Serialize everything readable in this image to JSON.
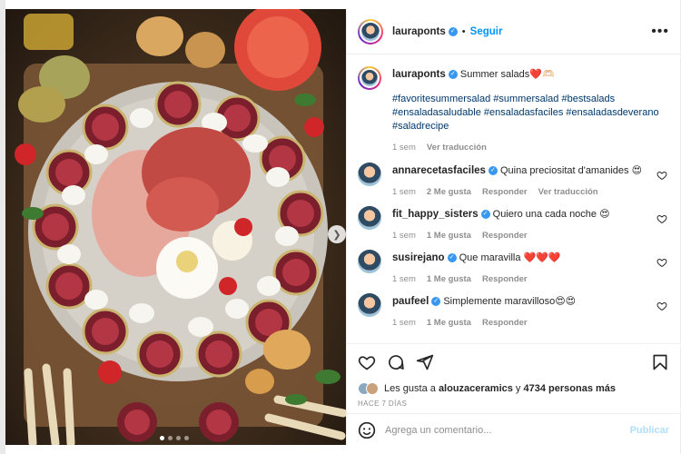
{
  "post": {
    "author": "lauraponts",
    "follow_label": "Seguir",
    "more_label": "•••",
    "caption_text": "Summer salads❤️🫶🏻",
    "hashtags": "#favoritesummersalad #summersalad #bestsalads #ensaladasaludable #ensaladasfaciles #ensaladasdeverano #saladrecipe",
    "caption_time": "1 sem",
    "caption_translate": "Ver traducción"
  },
  "comments": [
    {
      "user": "annarecetasfaciles",
      "text": "Quina preciositat d'amanides 😍",
      "time": "1 sem",
      "likes": "2 Me gusta",
      "reply": "Responder",
      "translate": "Ver traducción"
    },
    {
      "user": "fit_happy_sisters",
      "text": "Quiero una cada noche 😍",
      "time": "1 sem",
      "likes": "1 Me gusta",
      "reply": "Responder"
    },
    {
      "user": "susirejano",
      "text": "Que maravilla ❤️❤️❤️",
      "time": "1 sem",
      "likes": "1 Me gusta",
      "reply": "Responder"
    },
    {
      "user": "paufeel",
      "text": "Simplemente maravilloso😍😍",
      "time": "1 sem",
      "likes": "1 Me gusta",
      "reply": "Responder"
    }
  ],
  "likes": {
    "prefix": "Les gusta a ",
    "user": "alouzaceramics",
    "middle": " y ",
    "count": "4734 personas más"
  },
  "date": "HACE 7 DÍAS",
  "comment_box": {
    "placeholder": "Agrega un comentario...",
    "publish_label": "Publicar"
  },
  "carousel": {
    "slides": 4,
    "active": 0
  },
  "colors": {
    "accent": "#0095f6",
    "link": "#00376b",
    "muted": "#8e8e8e",
    "verified": "#3897f0"
  },
  "icons": [
    "heart-icon",
    "comment-icon",
    "share-icon",
    "bookmark-icon",
    "emoji-icon",
    "more-icon",
    "verified-badge-icon",
    "chevron-right-icon"
  ]
}
